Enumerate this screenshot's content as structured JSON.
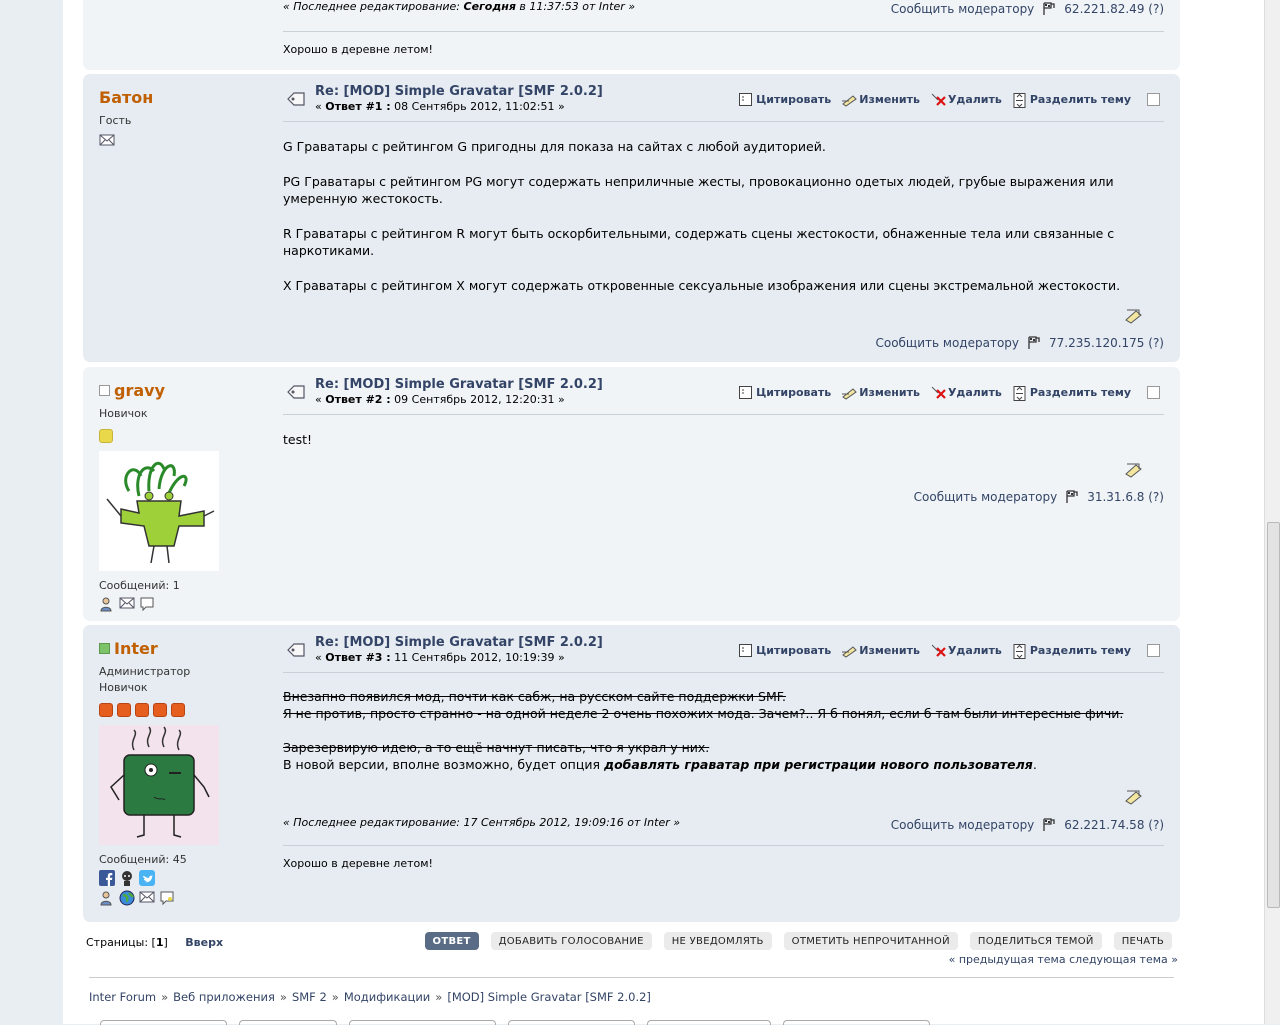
{
  "post0": {
    "last_edit_prefix": "« Последнее редактирование: ",
    "last_edit_when": "Сегодня",
    "last_edit_rest": " в 11:37:53 от Inter »",
    "report": "Сообщить модератору",
    "ip": "62.221.82.49 (?)",
    "signature": "Хорошо в деревне летом!"
  },
  "post1": {
    "name": "Батон",
    "title": "Гость",
    "subject": "Re: [MOD] Simple Gravatar [SMF 2.0.2]",
    "meta_prefix": "« ",
    "meta_reply": "Ответ #1 :",
    "meta_date": " 08 Сентябрь 2012, 11:02:51 »",
    "paragraphs": [
      "G Граватары с рейтингом G пригодны для показа на сайтах с любой аудиторией.",
      "PG Граватары с рейтингом PG могут содержать неприличные жесты, провокационно одетых людей, грубые выражения или умеренную жестокость.",
      "R Граватары с рейтингом R могут быть оскорбительными, содержать сцены жестокости, обнаженные тела или связанные с наркотиками.",
      "X Граватары с рейтингом X могут содержать откровенные сексуальные изображения или сцены экстремальной жестокости."
    ],
    "report": "Сообщить модератору",
    "ip": "77.235.120.175 (?)"
  },
  "post2": {
    "name": "gravy",
    "title": "Новичок",
    "posts_count": "Сообщений: 1",
    "subject": "Re: [MOD] Simple Gravatar [SMF 2.0.2]",
    "meta_prefix": "« ",
    "meta_reply": "Ответ #2 :",
    "meta_date": " 09 Сентябрь 2012, 12:20:31 »",
    "text": "test!",
    "report": "Сообщить модератору",
    "ip": "31.31.6.8 (?)"
  },
  "post3": {
    "name": "Inter",
    "title1": "Администратор",
    "title2": "Новичок",
    "posts_count": "Сообщений: 45",
    "subject": "Re: [MOD] Simple Gravatar [SMF 2.0.2]",
    "meta_prefix": "« ",
    "meta_reply": "Ответ #3 :",
    "meta_date": " 11 Сентябрь 2012, 10:19:39 »",
    "strike1": "Внезапно появился мод, почти как сабж,  на русском сайте поддержки SMF.",
    "strike2": "Я не против, просто странно - на одной неделе 2 очень похожих мода. Зачем?.. Я б понял, если б там были интересные фичи.",
    "strike3": "Зарезервирую идею, а то ещё начнут писать, что я украл у них.",
    "line_prefix": "В новой версии, вполне возможно, будет опция ",
    "line_bold": "добавлять граватар при регистрации нового пользователя",
    "line_suffix": ".",
    "last_edit": "« Последнее редактирование: 17 Сентябрь 2012, 19:09:16 от Inter »",
    "report": "Сообщить модератору",
    "ip": "62.221.74.58 (?)",
    "signature": "Хорошо в деревне летом!"
  },
  "actions": {
    "quote": "Цитировать",
    "edit": "Изменить",
    "delete": "Удалить",
    "split": "Разделить тему"
  },
  "bottom": {
    "pages_label": "Страницы: [",
    "pages_current": "1",
    "pages_close": "]",
    "top": "Вверх",
    "buttons": [
      "ОТВЕТ",
      "ДОБАВИТЬ ГОЛОСОВАНИЕ",
      "НЕ УВЕДОМЛЯТЬ",
      "ОТМЕТИТЬ НЕПРОЧИТАННОЙ",
      "ПОДЕЛИТЬСЯ ТЕМОЙ",
      "ПЕЧАТЬ"
    ],
    "prev_topic": "« предыдущая тема",
    "next_topic": "следующая тема »"
  },
  "breadcrumb": [
    "Inter Forum",
    "Веб приложения",
    "SMF 2",
    "Модификации",
    "[MOD] Simple Gravatar [SMF 2.0.2]"
  ],
  "breadcrumb_sep": "»",
  "colors": {
    "poster_name": "#c06002",
    "link": "#334466",
    "post_odd": "#f0f4f7",
    "post_even": "#e6ecf2",
    "button_active": "#5a6c85"
  }
}
